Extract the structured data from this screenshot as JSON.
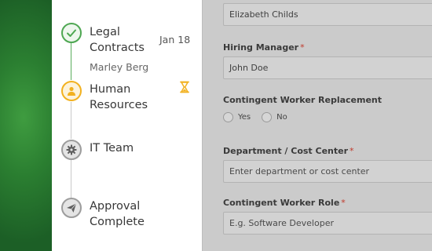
{
  "timeline": {
    "steps": [
      {
        "title": "Legal\nContracts",
        "subtitle": "Marley Berg",
        "date": "Jan 18",
        "status": "completed",
        "icon": "check-icon"
      },
      {
        "title": "Human\nResources",
        "status": "in-progress",
        "icon": "person-icon",
        "status_icon": "hourglass-icon"
      },
      {
        "title": "IT Team",
        "status": "pending",
        "icon": "gear-icon"
      },
      {
        "title": "Approval\nComplete",
        "status": "pending",
        "icon": "paper-plane-icon"
      }
    ]
  },
  "form": {
    "requester_value": "Elizabeth Childs",
    "hiring_manager": {
      "label": "Hiring Manager",
      "required_mark": "*",
      "value": "John Doe"
    },
    "contingent_replacement": {
      "label": "Contingent Worker Replacement",
      "options": [
        "Yes",
        "No"
      ]
    },
    "department": {
      "label": "Department / Cost Center",
      "required_mark": "*",
      "placeholder": "Enter department or cost center"
    },
    "role": {
      "label": "Contingent Worker Role",
      "required_mark": "*",
      "placeholder": "E.g. Software Developer"
    }
  },
  "colors": {
    "completed": "#4ea752",
    "in_progress": "#f2b11f",
    "pending": "#9c9c9c",
    "brand_green": "#2b7f31",
    "required": "#c0392b"
  }
}
